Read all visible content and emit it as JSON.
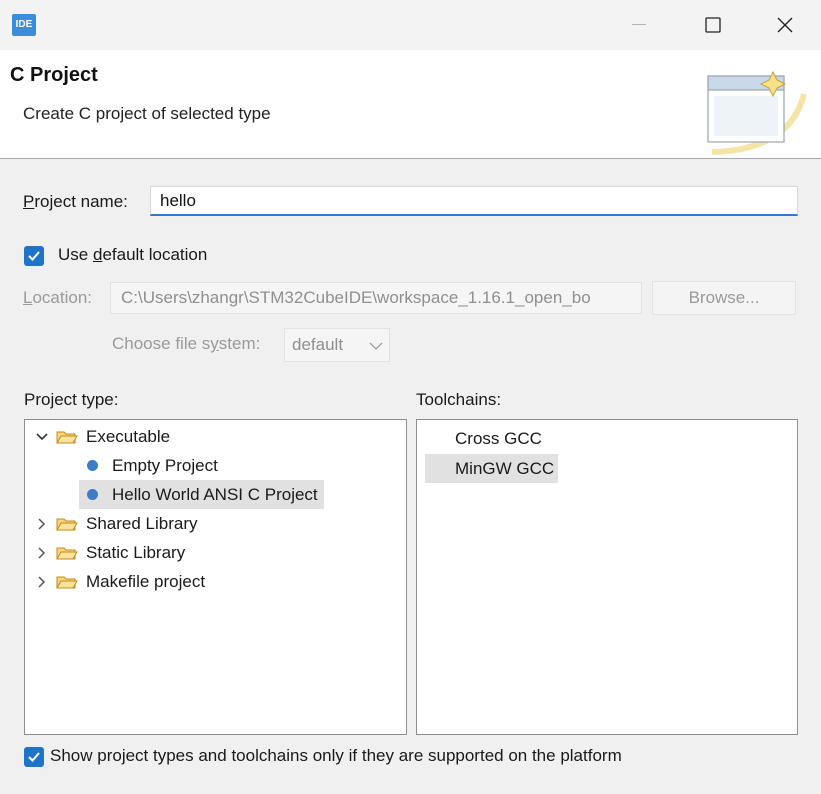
{
  "window": {
    "app_icon_text": "IDE"
  },
  "header": {
    "title": "C Project",
    "description": "Create C project of selected type"
  },
  "form": {
    "project_name_label_mnemonic": "P",
    "project_name_label_rest": "roject name:",
    "project_name_value": "hello",
    "use_default_pre": "Use ",
    "use_default_mnemonic": "d",
    "use_default_post": "efault location",
    "use_default_checked": true,
    "location_mnemonic": "L",
    "location_rest": "ocation:",
    "location_value": "C:\\Users\\zhangr\\STM32CubeIDE\\workspace_1.16.1_open_bo",
    "browse_label": "Browse...",
    "file_system_label_pre": "Choose file s",
    "file_system_label_mnemonic": "y",
    "file_system_label_post": "stem:",
    "file_system_value": "default"
  },
  "project_type": {
    "label": "Project type:",
    "items": [
      {
        "label": "Executable",
        "kind": "folder",
        "expanded": true
      },
      {
        "label": "Empty Project",
        "kind": "leaf"
      },
      {
        "label": "Hello World ANSI C Project",
        "kind": "leaf",
        "selected": true
      },
      {
        "label": "Shared Library",
        "kind": "folder",
        "expanded": false
      },
      {
        "label": "Static Library",
        "kind": "folder",
        "expanded": false
      },
      {
        "label": "Makefile project",
        "kind": "folder",
        "expanded": false
      }
    ]
  },
  "toolchains": {
    "label": "Toolchains:",
    "items": [
      {
        "label": "Cross GCC"
      },
      {
        "label": "MinGW GCC",
        "selected": true
      }
    ]
  },
  "footer": {
    "show_supported_label": "Show project types and toolchains only if they are supported on the platform",
    "show_supported_checked": true
  },
  "colors": {
    "accent": "#1f74c8",
    "selection": "#e1e1e1",
    "folder": "#e8a93a",
    "tree_dot": "#3d7dc6"
  }
}
